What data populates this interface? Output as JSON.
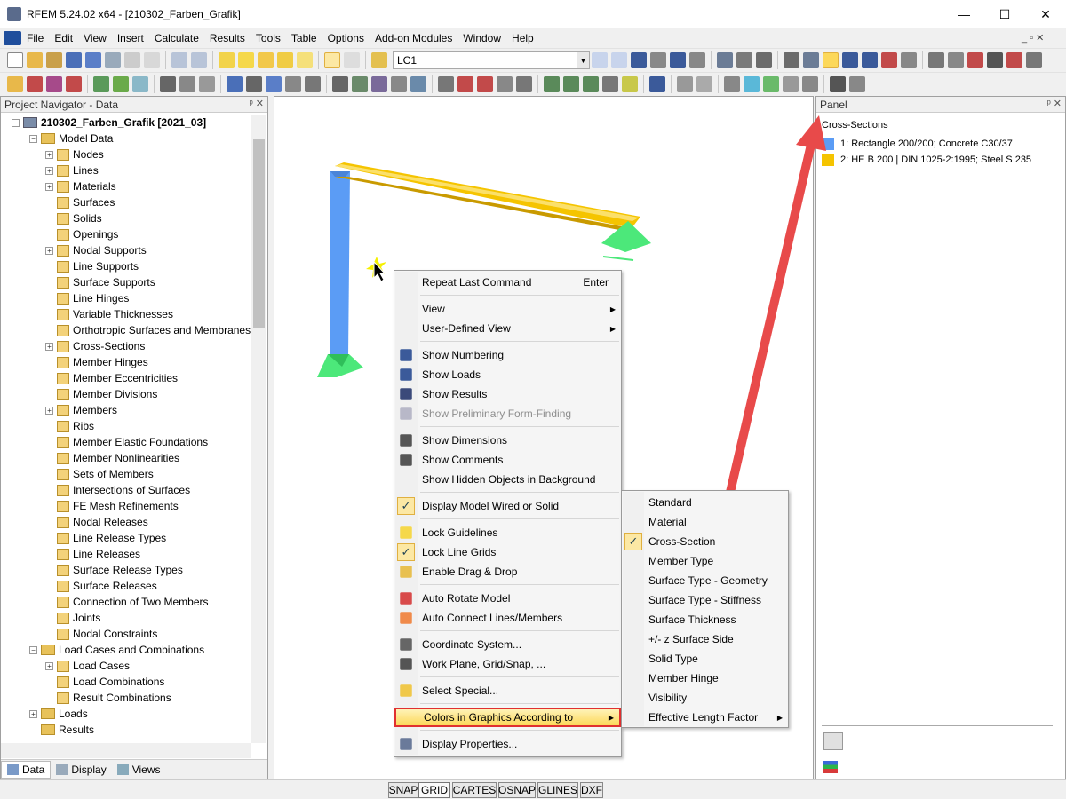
{
  "window": {
    "title": "RFEM 5.24.02 x64 - [210302_Farben_Grafik]",
    "minimize": "—",
    "maximize": "☐",
    "close": "✕"
  },
  "menu": [
    "File",
    "Edit",
    "View",
    "Insert",
    "Calculate",
    "Results",
    "Tools",
    "Table",
    "Options",
    "Add-on Modules",
    "Window",
    "Help"
  ],
  "mdi_controls": "_ ▫ ✕",
  "toolbar": {
    "load_case": "LC1"
  },
  "navigator": {
    "title": "Project Navigator - Data",
    "pane_controls": "ᵖ ✕",
    "items": [
      {
        "label": "210302_Farben_Grafik [2021_03]",
        "level": 0,
        "exp": "−",
        "bold": true
      },
      {
        "label": "Model Data",
        "level": 1,
        "exp": "−"
      },
      {
        "label": "Nodes",
        "level": 2,
        "exp": "+"
      },
      {
        "label": "Lines",
        "level": 2,
        "exp": "+"
      },
      {
        "label": "Materials",
        "level": 2,
        "exp": "+"
      },
      {
        "label": "Surfaces",
        "level": 2,
        "exp": ""
      },
      {
        "label": "Solids",
        "level": 2,
        "exp": ""
      },
      {
        "label": "Openings",
        "level": 2,
        "exp": ""
      },
      {
        "label": "Nodal Supports",
        "level": 2,
        "exp": "+"
      },
      {
        "label": "Line Supports",
        "level": 2,
        "exp": ""
      },
      {
        "label": "Surface Supports",
        "level": 2,
        "exp": ""
      },
      {
        "label": "Line Hinges",
        "level": 2,
        "exp": ""
      },
      {
        "label": "Variable Thicknesses",
        "level": 2,
        "exp": ""
      },
      {
        "label": "Orthotropic Surfaces and Membranes",
        "level": 2,
        "exp": ""
      },
      {
        "label": "Cross-Sections",
        "level": 2,
        "exp": "+"
      },
      {
        "label": "Member Hinges",
        "level": 2,
        "exp": ""
      },
      {
        "label": "Member Eccentricities",
        "level": 2,
        "exp": ""
      },
      {
        "label": "Member Divisions",
        "level": 2,
        "exp": ""
      },
      {
        "label": "Members",
        "level": 2,
        "exp": "+"
      },
      {
        "label": "Ribs",
        "level": 2,
        "exp": ""
      },
      {
        "label": "Member Elastic Foundations",
        "level": 2,
        "exp": ""
      },
      {
        "label": "Member Nonlinearities",
        "level": 2,
        "exp": ""
      },
      {
        "label": "Sets of Members",
        "level": 2,
        "exp": ""
      },
      {
        "label": "Intersections of Surfaces",
        "level": 2,
        "exp": ""
      },
      {
        "label": "FE Mesh Refinements",
        "level": 2,
        "exp": ""
      },
      {
        "label": "Nodal Releases",
        "level": 2,
        "exp": ""
      },
      {
        "label": "Line Release Types",
        "level": 2,
        "exp": ""
      },
      {
        "label": "Line Releases",
        "level": 2,
        "exp": ""
      },
      {
        "label": "Surface Release Types",
        "level": 2,
        "exp": ""
      },
      {
        "label": "Surface Releases",
        "level": 2,
        "exp": ""
      },
      {
        "label": "Connection of Two Members",
        "level": 2,
        "exp": ""
      },
      {
        "label": "Joints",
        "level": 2,
        "exp": ""
      },
      {
        "label": "Nodal Constraints",
        "level": 2,
        "exp": ""
      },
      {
        "label": "Load Cases and Combinations",
        "level": 1,
        "exp": "−"
      },
      {
        "label": "Load Cases",
        "level": 2,
        "exp": "+"
      },
      {
        "label": "Load Combinations",
        "level": 2,
        "exp": ""
      },
      {
        "label": "Result Combinations",
        "level": 2,
        "exp": ""
      },
      {
        "label": "Loads",
        "level": 1,
        "exp": "+"
      },
      {
        "label": "Results",
        "level": 1,
        "exp": ""
      }
    ],
    "tabs": [
      "Data",
      "Display",
      "Views"
    ]
  },
  "panel": {
    "title": "Panel",
    "pane_controls": "ᵖ ✕",
    "section": "Cross-Sections",
    "legend": [
      {
        "label": "1: Rectangle 200/200; Concrete C30/37",
        "color": "#5b9cf5"
      },
      {
        "label": "2: HE B 200 | DIN 1025-2:1995; Steel S 235",
        "color": "#f5c400"
      }
    ]
  },
  "context_menu": [
    {
      "label": "Repeat Last Command",
      "shortcut": "Enter"
    },
    {
      "sep": true
    },
    {
      "label": "View",
      "submenu": true
    },
    {
      "label": "User-Defined View",
      "submenu": true
    },
    {
      "sep": true
    },
    {
      "label": "Show Numbering",
      "icon": "numbering-icon"
    },
    {
      "label": "Show Loads",
      "icon": "loads-icon"
    },
    {
      "label": "Show Results",
      "icon": "eye-icon"
    },
    {
      "label": "Show Preliminary Form-Finding",
      "icon": "form-finding-icon",
      "disabled": true
    },
    {
      "sep": true
    },
    {
      "label": "Show Dimensions",
      "icon": "dimension-icon"
    },
    {
      "label": "Show Comments",
      "icon": "comment-icon"
    },
    {
      "label": "Show Hidden Objects in Background"
    },
    {
      "sep": true
    },
    {
      "label": "Display Model Wired or Solid",
      "checked": true
    },
    {
      "sep": true
    },
    {
      "label": "Lock Guidelines",
      "icon": "guidelines-icon"
    },
    {
      "label": "Lock Line Grids",
      "checked": true
    },
    {
      "label": "Enable Drag & Drop",
      "icon": "drag-drop-icon"
    },
    {
      "sep": true
    },
    {
      "label": "Auto Rotate Model",
      "icon": "rotate-icon"
    },
    {
      "label": "Auto Connect Lines/Members",
      "icon": "connect-icon"
    },
    {
      "sep": true
    },
    {
      "label": "Coordinate System...",
      "icon": "coordinate-icon"
    },
    {
      "label": "Work Plane, Grid/Snap, ...",
      "icon": "grid-icon"
    },
    {
      "sep": true
    },
    {
      "label": "Select Special...",
      "icon": "select-icon"
    },
    {
      "sep": true
    },
    {
      "label": "Colors in Graphics According to",
      "submenu": true,
      "highlighted": true
    },
    {
      "sep": true
    },
    {
      "label": "Display Properties...",
      "icon": "properties-icon"
    }
  ],
  "submenu": [
    {
      "label": "Standard"
    },
    {
      "label": "Material"
    },
    {
      "label": "Cross-Section",
      "checked": true
    },
    {
      "label": "Member Type"
    },
    {
      "label": "Surface Type - Geometry"
    },
    {
      "label": "Surface Type - Stiffness"
    },
    {
      "label": "Surface Thickness"
    },
    {
      "label": "+/- z Surface Side"
    },
    {
      "label": "Solid Type"
    },
    {
      "label": "Member Hinge"
    },
    {
      "label": "Visibility"
    },
    {
      "label": "Effective Length Factor",
      "submenu": true
    }
  ],
  "statusbar": [
    {
      "label": "SNAP",
      "on": false
    },
    {
      "label": "GRID",
      "on": true
    },
    {
      "label": "CARTES",
      "on": false
    },
    {
      "label": "OSNAP",
      "on": false
    },
    {
      "label": "GLINES",
      "on": false
    },
    {
      "label": "DXF",
      "on": false
    }
  ],
  "colors": {
    "arrow": "#e84a4a",
    "highlight_border": "#e03030",
    "member_concrete": "#5b9cf5",
    "member_steel": "#f5c400",
    "support": "#4ce87a"
  }
}
